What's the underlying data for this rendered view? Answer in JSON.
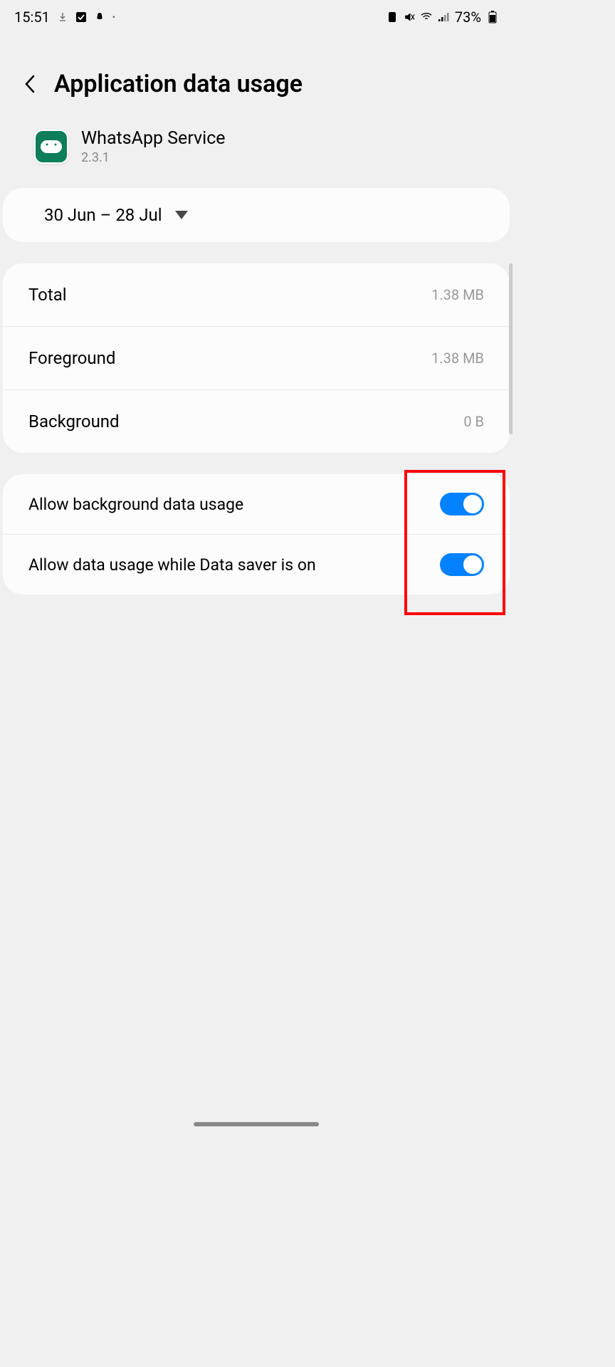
{
  "status_bar": {
    "time": "15:51",
    "battery_percent": "73%"
  },
  "header": {
    "title": "Application data usage"
  },
  "app": {
    "name": "WhatsApp Service",
    "version": "2.3.1"
  },
  "date_range": "30 Jun – 28 Jul",
  "usage": [
    {
      "label": "Total",
      "value": "1.38 MB"
    },
    {
      "label": "Foreground",
      "value": "1.38 MB"
    },
    {
      "label": "Background",
      "value": "0 B"
    }
  ],
  "toggles": [
    {
      "label": "Allow background data usage",
      "enabled": true
    },
    {
      "label": "Allow data usage while Data saver is on",
      "enabled": true
    }
  ]
}
